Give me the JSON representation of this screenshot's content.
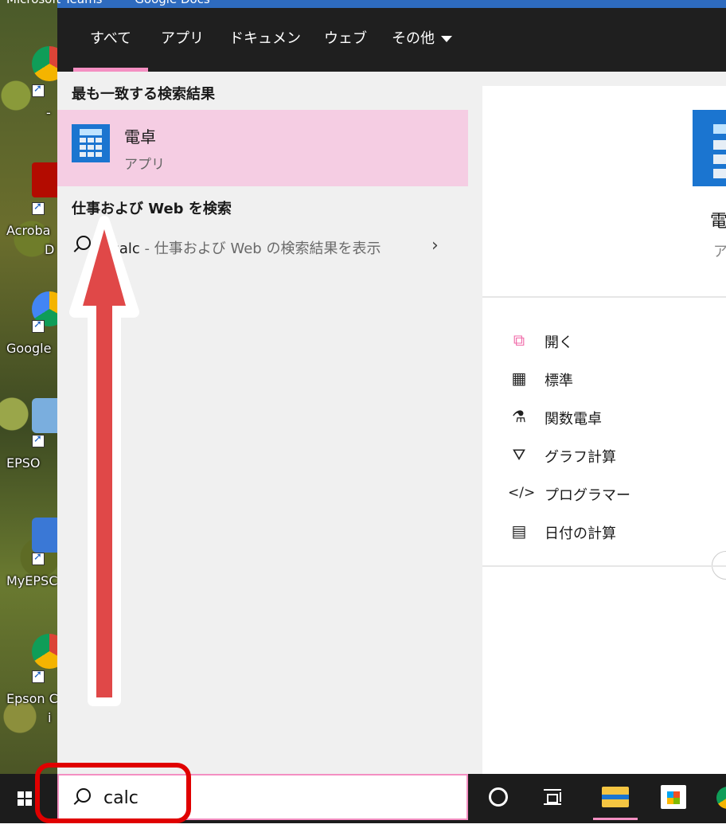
{
  "desktop": {
    "top_labels": [
      "Microsoft Teams",
      "Google Docs"
    ],
    "icons": [
      {
        "label": "-"
      },
      {
        "label": "Acroba"
      },
      {
        "label": "D"
      },
      {
        "label": "Google"
      },
      {
        "label": "EPSO"
      },
      {
        "label": "MyEPSC"
      },
      {
        "label": "Epson C"
      },
      {
        "label": "i"
      }
    ]
  },
  "search_panel": {
    "tabs": [
      {
        "label": "すべて",
        "active": true
      },
      {
        "label": "アプリ"
      },
      {
        "label": "ドキュメント"
      },
      {
        "label": "ウェブ"
      },
      {
        "label": "その他"
      }
    ],
    "best_match_heading": "最も一致する検索結果",
    "best_match": {
      "name": "電卓",
      "type": "アプリ"
    },
    "web_heading": "仕事および Web を検索",
    "web_query": "calc",
    "web_suffix": " - 仕事および Web の検索結果を表示"
  },
  "detail_panel": {
    "name": "電",
    "type": "ア",
    "actions": [
      {
        "label": "開く",
        "icon": "open-icon"
      },
      {
        "label": "標準",
        "icon": "calculator-icon"
      },
      {
        "label": "関数電卓",
        "icon": "flask-icon"
      },
      {
        "label": "グラフ計算",
        "icon": "graph-icon"
      },
      {
        "label": "プログラマー",
        "icon": "code-icon"
      },
      {
        "label": "日付の計算",
        "icon": "calendar-icon"
      }
    ]
  },
  "taskbar": {
    "search_value": "calc"
  },
  "colors": {
    "accent_pink": "#f48fc2",
    "highlight_row": "#f5cde3",
    "annotation_red": "#e04848",
    "annotation_box_red": "#e00000"
  }
}
